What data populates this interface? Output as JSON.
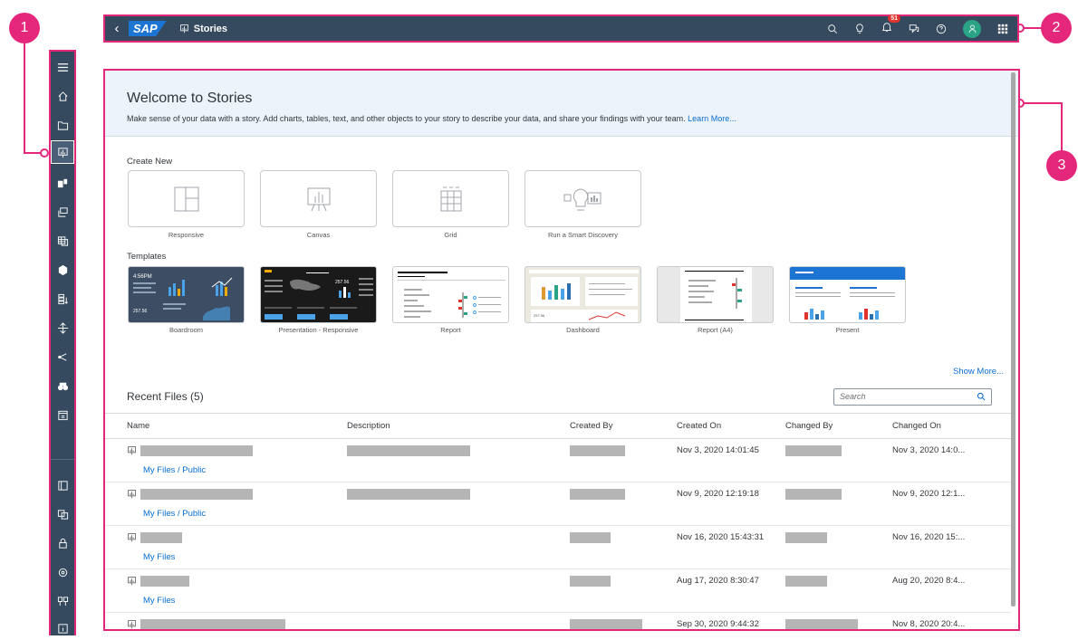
{
  "callouts": [
    "1",
    "2",
    "3"
  ],
  "shell": {
    "logo": "SAP",
    "title": "Stories",
    "notification_count": "51",
    "icons": [
      "search-icon",
      "lightbulb-icon",
      "bell-icon",
      "discussion-icon",
      "help-icon",
      "user-avatar-icon",
      "app-grid-icon"
    ]
  },
  "sidebar": {
    "items": [
      "menu-icon",
      "home-icon",
      "files-icon",
      "stories-icon",
      "analytic-app-icon",
      "digital-boardroom-icon",
      "datasets-icon",
      "modeler-icon",
      "data-analyzer-icon",
      "connections-icon",
      "share-icon",
      "explorer-icon",
      "calendar-icon",
      "catalog-icon",
      "translation-icon",
      "security-icon",
      "system-icon",
      "deployment-icon",
      "info-icon"
    ]
  },
  "welcome": {
    "title": "Welcome to Stories",
    "text": "Make sense of your data with a story. Add charts, tables, text, and other objects to your story to describe your data, and share your findings with your team.",
    "link": "Learn More..."
  },
  "create_new": {
    "label": "Create New",
    "tiles": [
      "Responsive",
      "Canvas",
      "Grid",
      "Run a Smart Discovery"
    ]
  },
  "templates": {
    "label": "Templates",
    "items": [
      "Boardroom",
      "Presentation - Responsive",
      "Report",
      "Dashboard",
      "Report (A4)",
      "Present"
    ],
    "thumb_boardroom_time": "4:56PM",
    "thumb_boardroom_value": "257.56",
    "thumb_presentation_value": "257.56",
    "thumb_dashboard_value": "257.56"
  },
  "show_more": "Show More...",
  "recent": {
    "title": "Recent Files (5)",
    "search_placeholder": "Search",
    "columns": [
      "Name",
      "Description",
      "Created By",
      "Created On",
      "Changed By",
      "Changed On"
    ],
    "rows": [
      {
        "path": "My Files / Public",
        "created_on": "Nov 3, 2020 14:01:45",
        "changed_on": "Nov 3, 2020 14:0..."
      },
      {
        "path": "My Files / Public",
        "created_on": "Nov 9, 2020 12:19:18",
        "changed_on": "Nov 9, 2020 12:1..."
      },
      {
        "path": "My Files",
        "created_on": "Nov 16, 2020 15:43:31",
        "changed_on": "Nov 16, 2020 15:..."
      },
      {
        "path": "My Files",
        "created_on": "Aug 17, 2020 8:30:47",
        "changed_on": "Aug 20, 2020 8:4..."
      },
      {
        "path": "",
        "created_on": "Sep 30, 2020 9:44:32",
        "changed_on": "Nov 8, 2020 20:4..."
      }
    ]
  },
  "colors": {
    "accent": "#0a6ed1",
    "shell": "#354a5f",
    "callout": "#e5277b",
    "badge": "#e0332d",
    "avatar": "#2aa387"
  }
}
